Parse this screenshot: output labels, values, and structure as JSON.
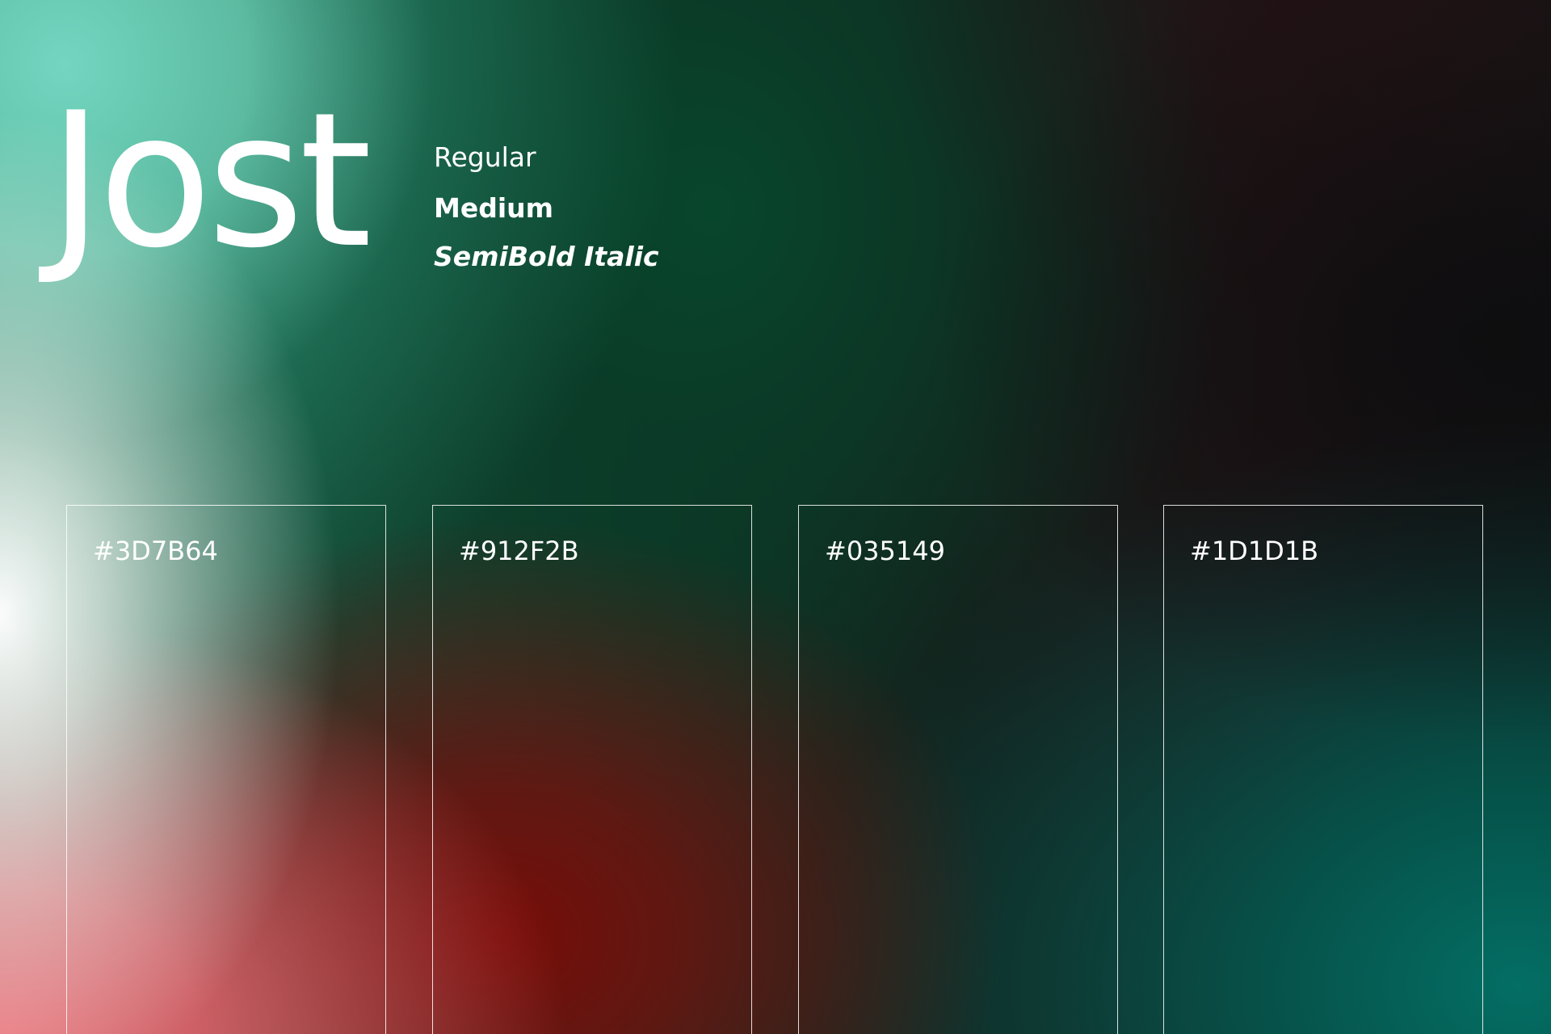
{
  "title": "Jost",
  "weights": {
    "regular": "Regular",
    "medium": "Medium",
    "semibold_italic": "SemiBold Italic"
  },
  "swatches": [
    {
      "label": "#3D7B64",
      "color": "#3D7B64"
    },
    {
      "label": "#912F2B",
      "color": "#912F2B"
    },
    {
      "label": "#035149",
      "color": "#035149"
    },
    {
      "label": "#1D1D1B",
      "color": "#1D1D1B"
    }
  ],
  "colors": {
    "text": "#FFFFFF",
    "gradient_mint": "#73D6C0",
    "gradient_pink": "#E96E76",
    "gradient_red": "#780C08",
    "gradient_teal": "#046E64"
  }
}
